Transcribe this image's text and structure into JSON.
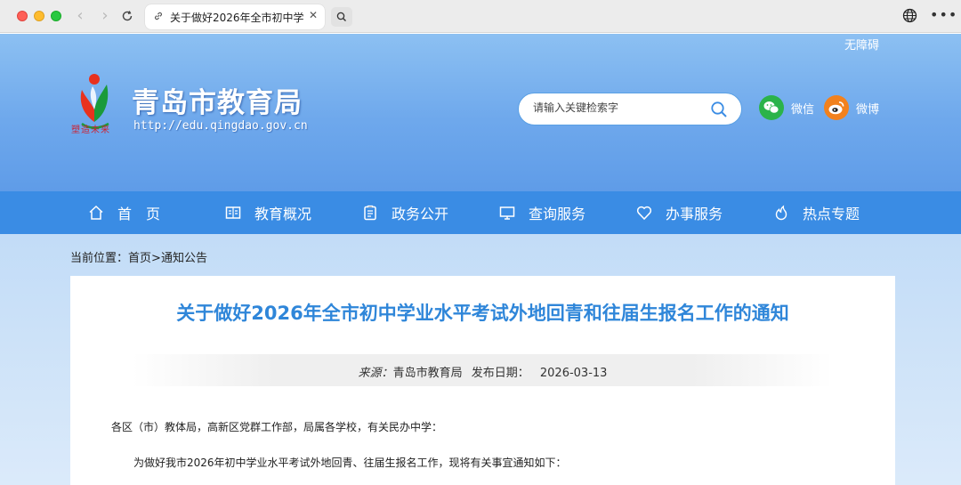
{
  "browser": {
    "tab_title": "关于做好2026年全市初中学业",
    "tab_close": "✕",
    "icons": [
      "link-icon",
      "search-icon",
      "globe-icon",
      "more-icon",
      "reload-icon",
      "back-icon",
      "forward-icon"
    ]
  },
  "header": {
    "accessibility_label": "无障碍",
    "site_name": "青岛市教育局",
    "site_url": "http://edu.qingdao.gov.cn",
    "seal_text": "塑造未来",
    "search_placeholder": "请输入关键检索字",
    "wechat_label": "微信",
    "weibo_label": "微博"
  },
  "nav": {
    "items": [
      {
        "label": "首　页",
        "icon": "home-icon"
      },
      {
        "label": "教育概况",
        "icon": "book-icon"
      },
      {
        "label": "政务公开",
        "icon": "clipboard-icon"
      },
      {
        "label": "查询服务",
        "icon": "monitor-icon"
      },
      {
        "label": "办事服务",
        "icon": "heart-icon"
      },
      {
        "label": "热点专题",
        "icon": "flame-icon"
      }
    ]
  },
  "breadcrumb": {
    "prefix": "当前位置：",
    "home": "首页",
    "separator": ">",
    "current": "通知公告"
  },
  "article": {
    "title": "关于做好2026年全市初中学业水平考试外地回青和往届生报名工作的通知",
    "source_label": "来源：",
    "source": "青岛市教育局",
    "date_label": "发布日期：",
    "date": "2026-03-13",
    "paragraph1": "各区（市）教体局，高新区党群工作部，局属各学校，有关民办中学：",
    "paragraph2": "为做好我市2026年初中学业水平考试外地回青、往届生报名工作，现将有关事宜通知如下："
  },
  "colors": {
    "nav_bg": "#3a8ce4",
    "title_blue": "#2f86d9",
    "wechat_green": "#2bb34a",
    "weibo_orange": "#f2811d"
  }
}
